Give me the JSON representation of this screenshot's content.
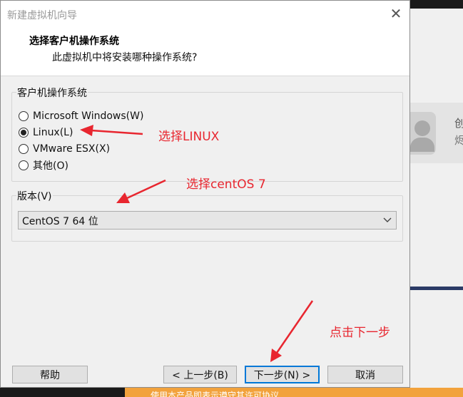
{
  "background_app": {
    "card_text_1": "创",
    "card_text_2": "烬",
    "banner_text": "使用本产品即表示遵守其许可协议"
  },
  "dialog": {
    "title": "新建虚拟机向导",
    "header_title": "选择客户机操作系统",
    "header_subtitle": "此虚拟机中将安装哪种操作系统?",
    "os_group_label": "客户机操作系统",
    "os_options": [
      {
        "label": "Microsoft Windows(W)",
        "selected": false
      },
      {
        "label": "Linux(L)",
        "selected": true
      },
      {
        "label": "VMware ESX(X)",
        "selected": false
      },
      {
        "label": "其他(O)",
        "selected": false
      }
    ],
    "version_group_label": "版本(V)",
    "version_selected": "CentOS 7 64 位",
    "buttons": {
      "help": "帮助",
      "back": "< 上一步(B)",
      "next": "下一步(N) >",
      "cancel": "取消"
    }
  },
  "annotations": {
    "linux": "选择LINUX",
    "centos": "选择centOS 7",
    "next": "点击下一步",
    "color": "#e8262f"
  }
}
